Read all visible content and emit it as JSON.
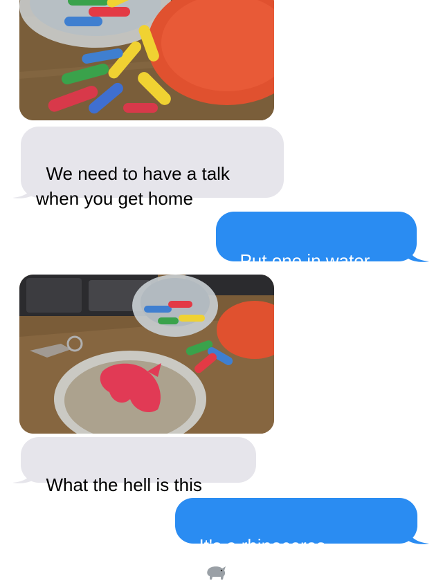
{
  "conversation": {
    "messages": [
      {
        "sender": "them",
        "type": "image",
        "description_icon": "photo-pills-bowl-icon"
      },
      {
        "sender": "them",
        "type": "text",
        "text": "We need to have a talk\nwhen you get home"
      },
      {
        "sender": "me",
        "type": "text",
        "text": "Put one in water"
      },
      {
        "sender": "them",
        "type": "image",
        "description_icon": "photo-foam-rhino-icon"
      },
      {
        "sender": "them",
        "type": "text",
        "text": "What the hell is this"
      },
      {
        "sender": "me",
        "type": "text",
        "text": "It's a rhinoceros",
        "emoji": "rhinoceros-emoji"
      }
    ]
  },
  "colors": {
    "received_bubble": "#e6e5eb",
    "sent_bubble": "#2a8cf2",
    "sent_text": "#ffffff",
    "received_text": "#000000"
  }
}
